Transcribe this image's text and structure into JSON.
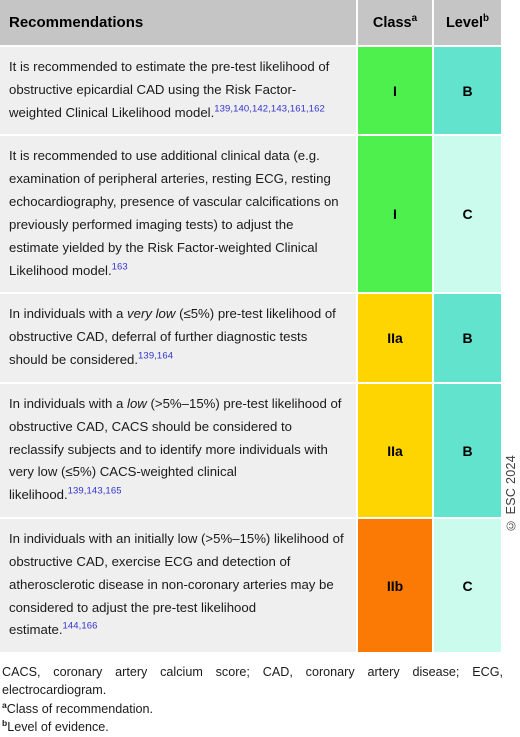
{
  "table": {
    "headers": {
      "recommendations": "Recommendations",
      "class": "Class",
      "class_note": "a",
      "level": "Level",
      "level_note": "b"
    },
    "rows": [
      {
        "text_parts": [
          {
            "type": "plain",
            "text": "It is recommended to estimate the pre-test likelihood of obstructive epicardial CAD using the Risk Factor-weighted Clinical Likelihood model."
          },
          {
            "type": "ref",
            "text": "139,140,142,143,161,162"
          }
        ],
        "class": "I",
        "level": "B",
        "class_color": "#4ef04e",
        "level_color": "#62e3ce"
      },
      {
        "text_parts": [
          {
            "type": "plain",
            "text": "It is recommended to use additional clinical data (e.g. examination of peripheral arteries, resting ECG, resting echocardiography, presence of vascular calcifications on previously performed imaging tests) to adjust the estimate yielded by the Risk Factor-weighted Clinical Likelihood model."
          },
          {
            "type": "ref",
            "text": "163"
          }
        ],
        "class": "I",
        "level": "C",
        "class_color": "#4ef04e",
        "level_color": "#cbfbec"
      },
      {
        "text_parts": [
          {
            "type": "plain",
            "text": "In individuals with a "
          },
          {
            "type": "italic",
            "text": "very low"
          },
          {
            "type": "plain",
            "text": " (≤5%) pre-test likelihood of obstructive CAD, deferral of further diagnostic tests should be considered."
          },
          {
            "type": "ref",
            "text": "139,164"
          }
        ],
        "class": "IIa",
        "level": "B",
        "class_color": "#ffd500",
        "level_color": "#62e3ce"
      },
      {
        "text_parts": [
          {
            "type": "plain",
            "text": "In individuals with a "
          },
          {
            "type": "italic",
            "text": "low"
          },
          {
            "type": "plain",
            "text": " (>5%–15%) pre-test likelihood of obstructive CAD, CACS should be considered to reclassify subjects and to identify more individuals with very low (≤5%) CACS-weighted clinical likelihood."
          },
          {
            "type": "ref",
            "text": "139,143,165"
          }
        ],
        "class": "IIa",
        "level": "B",
        "class_color": "#ffd500",
        "level_color": "#62e3ce"
      },
      {
        "text_parts": [
          {
            "type": "plain",
            "text": "In individuals with an initially low (>5%–15%) likelihood of obstructive CAD, exercise ECG and detection of atherosclerotic disease in non-coronary arteries may be considered to adjust the pre-test likelihood estimate."
          },
          {
            "type": "ref",
            "text": "144,166"
          }
        ],
        "class": "IIb",
        "level": "C",
        "class_color": "#fa7a05",
        "level_color": "#cbfbec"
      }
    ]
  },
  "copyright": "© ESC 2024",
  "footnotes": {
    "abbreviations": "CACS, coronary artery calcium score; CAD, coronary artery disease; ECG, electrocardiogram.",
    "note_a_marker": "a",
    "note_a": "Class of recommendation.",
    "note_b_marker": "b",
    "note_b": "Level of evidence."
  }
}
